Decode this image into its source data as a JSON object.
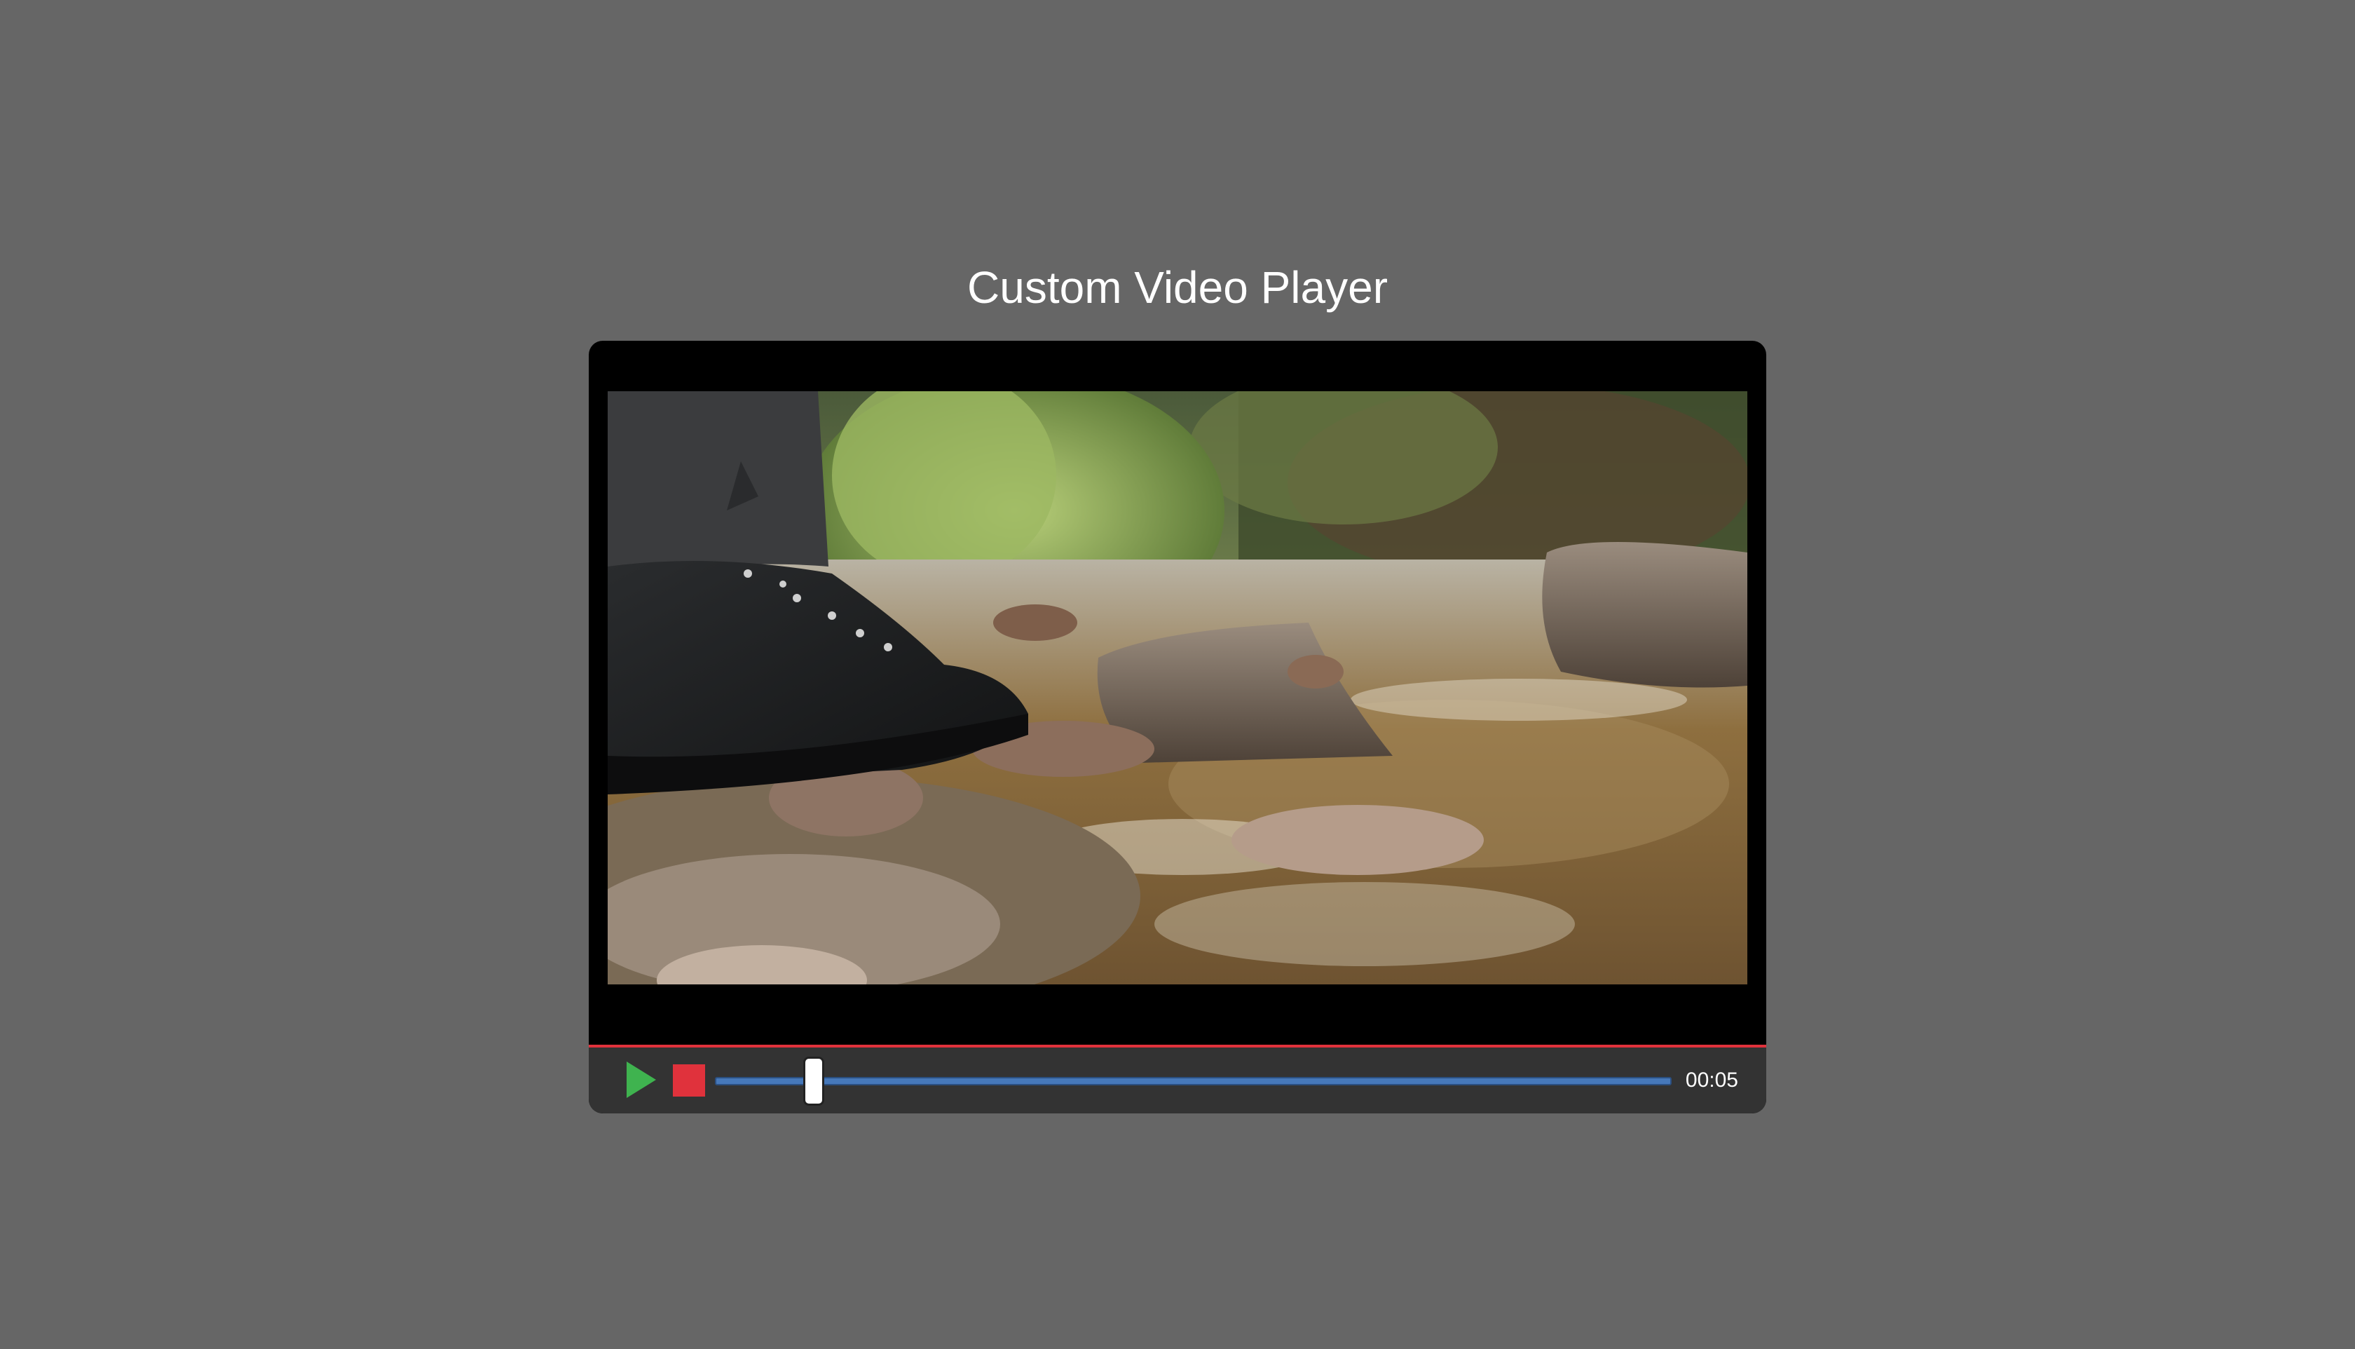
{
  "page": {
    "title": "Custom Video Player"
  },
  "player": {
    "video": {
      "description_icon": "video-frame",
      "playing": false
    },
    "controls": {
      "play_icon": "play-icon",
      "stop_icon": "stop-icon",
      "progress_fraction": 0.103,
      "timestamp": "00:05"
    },
    "colors": {
      "background": "#666666",
      "player_bg": "#000000",
      "controls_bg": "#333333",
      "accent_line": "#e0323c",
      "play": "#3fb34f",
      "stop": "#e0323c",
      "track": "#4678b9"
    }
  }
}
